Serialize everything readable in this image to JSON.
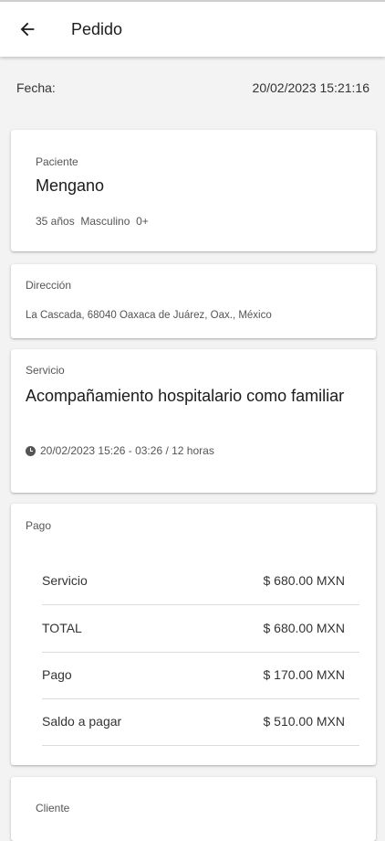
{
  "appbar": {
    "title": "Pedido",
    "back_icon": "arrow-left-icon"
  },
  "fecha": {
    "label": "Fecha:",
    "value": "20/02/2023 15:21:16"
  },
  "paciente": {
    "label": "Paciente",
    "name": "Mengano",
    "age": "35 años",
    "sex": "Masculino",
    "blood": "0+"
  },
  "direccion": {
    "label": "Dirección",
    "address": "La Cascada, 68040 Oaxaca de Juárez, Oax., México"
  },
  "servicio": {
    "label": "Servicio",
    "title": "Acompañamiento hospitalario como familiar",
    "time_icon": "clock-icon",
    "time": "20/02/2023 15:26 - 03:26 / 12 horas"
  },
  "pago": {
    "label": "Pago",
    "rows": [
      {
        "label": "Servicio",
        "value": "$ 680.00 MXN"
      },
      {
        "label": "TOTAL",
        "value": "$ 680.00 MXN"
      },
      {
        "label": "Pago",
        "value": "$ 170.00 MXN"
      },
      {
        "label": "Saldo a pagar",
        "value": "$ 510.00 MXN"
      }
    ]
  },
  "cliente": {
    "label": "Cliente"
  }
}
